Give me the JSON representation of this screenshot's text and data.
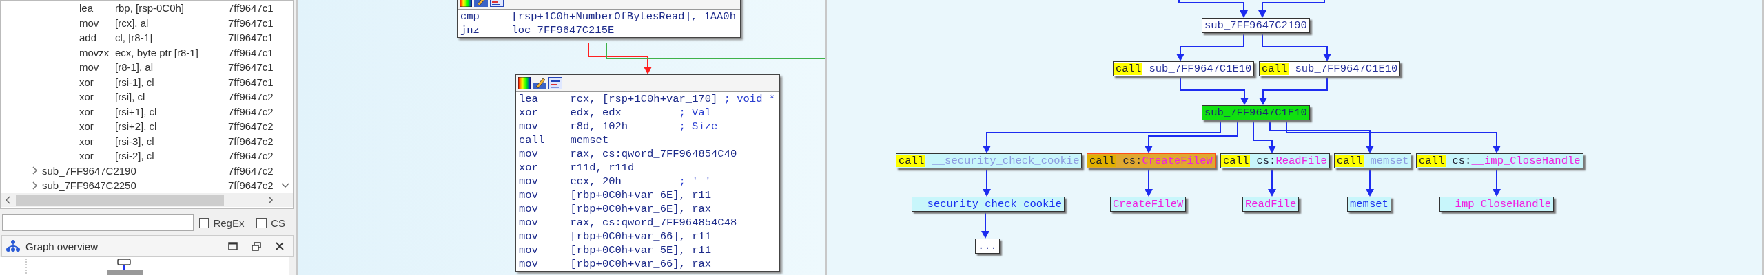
{
  "function_list": {
    "rows": [
      {
        "kind": "instruction",
        "mnemonic": "lea",
        "operands": "rbp, [rsp-0C0h]",
        "address": "7ff9647c1"
      },
      {
        "kind": "instruction",
        "mnemonic": "mov",
        "operands": "[rcx], al",
        "address": "7ff9647c1"
      },
      {
        "kind": "instruction",
        "mnemonic": "add",
        "operands": "cl, [r8-1]",
        "address": "7ff9647c1"
      },
      {
        "kind": "instruction",
        "mnemonic": "movzx",
        "operands": "ecx, byte ptr [r8-1]",
        "address": "7ff9647c1"
      },
      {
        "kind": "instruction",
        "mnemonic": "mov",
        "operands": "[r8-1], al",
        "address": "7ff9647c1"
      },
      {
        "kind": "instruction",
        "mnemonic": "xor",
        "operands": "[rsi-1], cl",
        "address": "7ff9647c1"
      },
      {
        "kind": "instruction",
        "mnemonic": "xor",
        "operands": "[rsi], cl",
        "address": "7ff9647c2"
      },
      {
        "kind": "instruction",
        "mnemonic": "xor",
        "operands": "[rsi+1], cl",
        "address": "7ff9647c2"
      },
      {
        "kind": "instruction",
        "mnemonic": "xor",
        "operands": "[rsi+2], cl",
        "address": "7ff9647c2"
      },
      {
        "kind": "instruction",
        "mnemonic": "xor",
        "operands": "[rsi-3], cl",
        "address": "7ff9647c2"
      },
      {
        "kind": "instruction",
        "mnemonic": "xor",
        "operands": "[rsi-2], cl",
        "address": "7ff9647c2"
      },
      {
        "kind": "function",
        "name": "sub_7FF9647C2190",
        "address": "7ff9647c2",
        "expanded": false
      },
      {
        "kind": "function",
        "name": "sub_7FF9647C2250",
        "address": "7ff9647c2",
        "expanded": false
      }
    ]
  },
  "filter_options": [
    {
      "label": "RegEx",
      "checked": false
    },
    {
      "label": "CS",
      "checked": false
    }
  ],
  "graph_overview": {
    "title": "Graph overview"
  },
  "disassembly": {
    "blocks": [
      {
        "lines": [
          {
            "mnemonic": "cmp",
            "operands": "[rsp+1C0h+NumberOfBytesRead], 1AA0h"
          },
          {
            "mnemonic": "jnz",
            "operands": "loc_7FF9647C215E"
          }
        ]
      },
      {
        "lines": [
          {
            "mnemonic": "lea",
            "operands": "rcx, [rsp+1C0h+var_170]",
            "comment": "; void *"
          },
          {
            "mnemonic": "xor",
            "operands": "edx, edx",
            "comment": "; Val"
          },
          {
            "mnemonic": "mov",
            "operands": "r8d, 102h",
            "comment": "; Size"
          },
          {
            "mnemonic": "call",
            "operands": "memset"
          },
          {
            "mnemonic": "mov",
            "operands": "rax, cs:qword_7FF964854C40"
          },
          {
            "mnemonic": "xor",
            "operands": "r11d, r11d"
          },
          {
            "mnemonic": "mov",
            "operands": "ecx, 20h",
            "comment": "; ' '"
          },
          {
            "mnemonic": "mov",
            "operands": "[rbp+0C0h+var_6E], r11"
          },
          {
            "mnemonic": "mov",
            "operands": "[rbp+0C0h+var_6E], rax"
          },
          {
            "mnemonic": "mov",
            "operands": "rax, cs:qword_7FF964854C48"
          },
          {
            "mnemonic": "mov",
            "operands": "[rbp+0C0h+var_66], r11"
          },
          {
            "mnemonic": "mov",
            "operands": "[rbp+0C0h+var_5E], r11"
          },
          {
            "mnemonic": "mov",
            "operands": "[rbp+0C0h+var_66], rax"
          }
        ]
      }
    ]
  },
  "proximity_graph": {
    "nodes": [
      {
        "kind": "function",
        "name": "sub_7FF9647C2190",
        "imported": false,
        "library": false
      },
      {
        "kind": "call",
        "keyword": "call",
        "name": "sub_7FF9647C1E10",
        "imported": false,
        "library": false,
        "selected": false
      },
      {
        "kind": "call",
        "keyword": "call",
        "name": "sub_7FF9647C1E10",
        "imported": false,
        "library": false,
        "selected": false
      },
      {
        "kind": "current",
        "name": "sub_7FF9647C1E10",
        "imported": false,
        "library": false
      },
      {
        "kind": "call",
        "keyword": "call",
        "name": "__security_check_cookie",
        "imported": false,
        "library": true,
        "selected": false
      },
      {
        "kind": "call",
        "keyword": "call",
        "segment": "cs:",
        "name": "CreateFileW",
        "imported": true,
        "library": false,
        "selected": true
      },
      {
        "kind": "call",
        "keyword": "call",
        "segment": "cs:",
        "name": "ReadFile",
        "imported": true,
        "library": false,
        "selected": false
      },
      {
        "kind": "call",
        "keyword": "call",
        "name": "memset",
        "imported": false,
        "library": true,
        "selected": false
      },
      {
        "kind": "call",
        "keyword": "call",
        "segment": "cs:",
        "name": "__imp_CloseHandle",
        "imported": true,
        "library": false,
        "selected": false
      },
      {
        "kind": "function",
        "name": "__security_check_cookie",
        "imported": false,
        "library": true
      },
      {
        "kind": "function",
        "name": "CreateFileW",
        "imported": true,
        "library": false
      },
      {
        "kind": "function",
        "name": "ReadFile",
        "imported": true,
        "library": false
      },
      {
        "kind": "function",
        "name": "memset",
        "imported": false,
        "library": true
      },
      {
        "kind": "function",
        "name": "__imp_CloseHandle",
        "imported": true,
        "library": false
      },
      {
        "kind": "more",
        "name": "..."
      }
    ]
  }
}
